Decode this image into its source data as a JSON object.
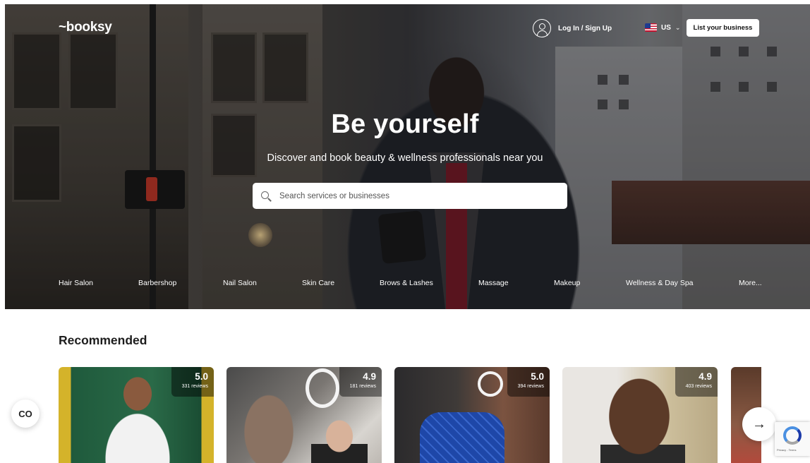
{
  "nav": {
    "logo": "booksy",
    "login_label": "Log In / Sign Up",
    "country": "US",
    "list_business": "List your business"
  },
  "hero": {
    "headline": "Be yourself",
    "subline": "Discover and book beauty & wellness professionals near you",
    "search_placeholder": "Search services or businesses"
  },
  "categories": [
    "Hair Salon",
    "Barbershop",
    "Nail Salon",
    "Skin Care",
    "Brows & Lashes",
    "Massage",
    "Makeup",
    "Wellness & Day Spa",
    "More..."
  ],
  "recommended": {
    "title": "Recommended",
    "cards": [
      {
        "rating": "5.0",
        "reviews": "331 reviews"
      },
      {
        "rating": "4.9",
        "reviews": "181 reviews"
      },
      {
        "rating": "5.0",
        "reviews": "394 reviews"
      },
      {
        "rating": "4.9",
        "reviews": "403 reviews"
      }
    ]
  },
  "widgets": {
    "co_label": "CO",
    "next_arrow": "→",
    "recaptcha_text": "Privacy - Terms"
  },
  "icons": {
    "search": "search-icon",
    "user": "user-icon",
    "flag": "us-flag-icon",
    "next": "arrow-right-icon"
  }
}
